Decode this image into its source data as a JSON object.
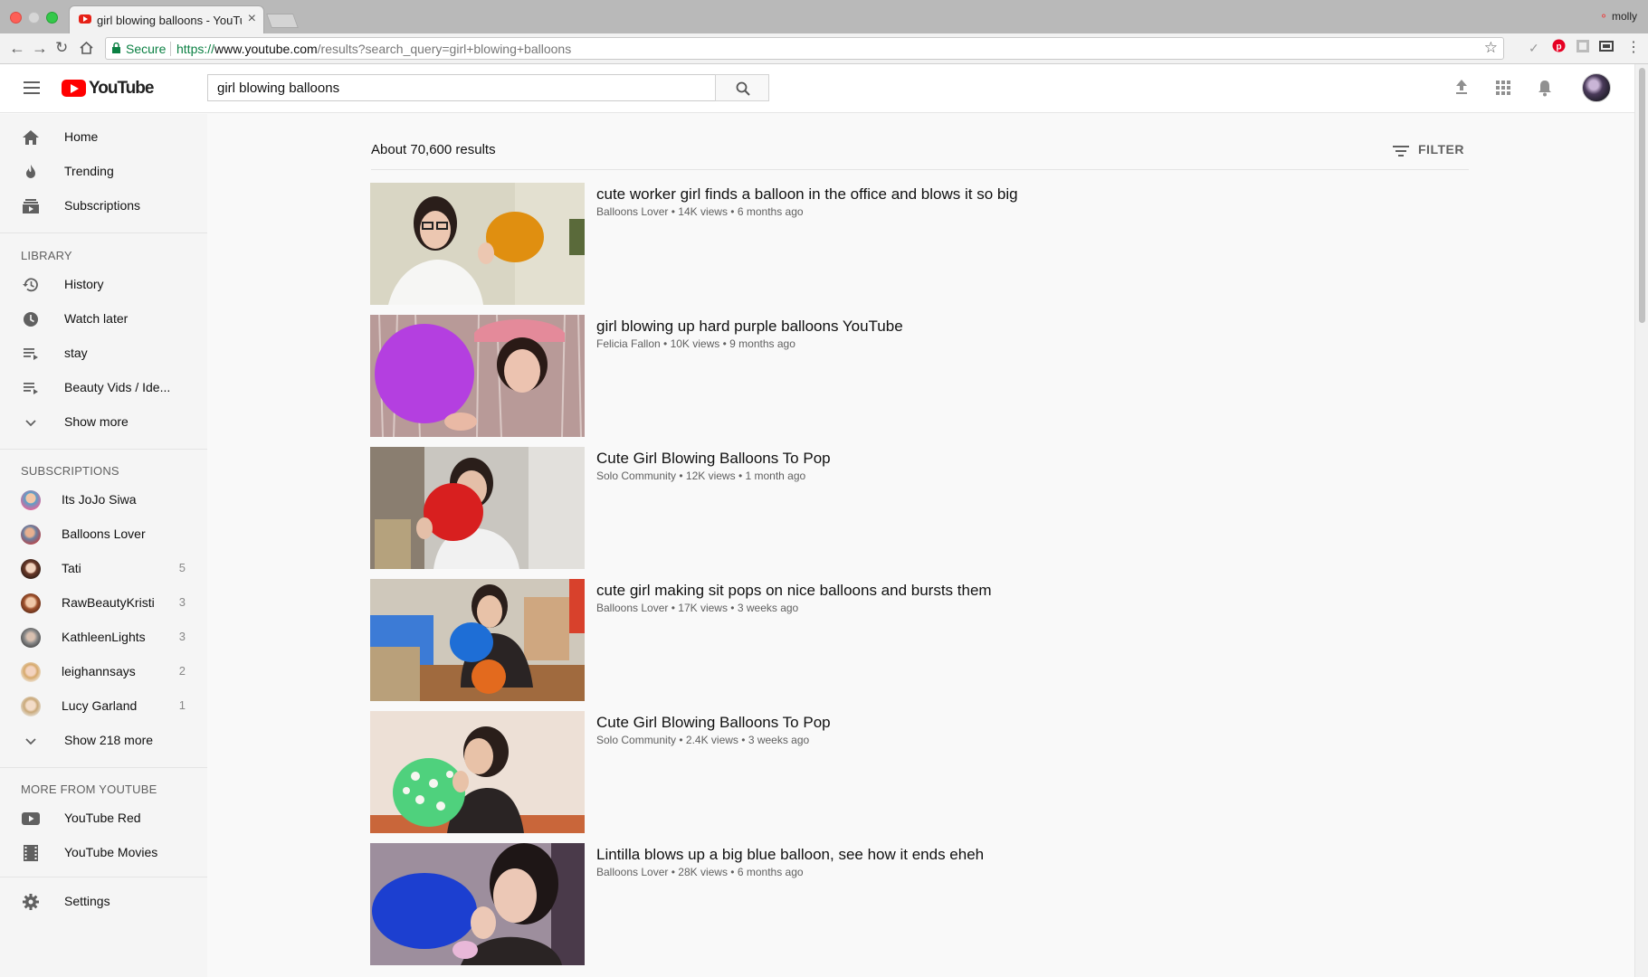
{
  "browser": {
    "tab_title": "girl blowing balloons - YouTube",
    "tab_close": "×",
    "profile": "molly",
    "secure_label": "Secure",
    "url_scheme": "https://",
    "url_host": "www.youtube.com",
    "url_path": "/results?search_query=girl+blowing+balloons"
  },
  "masthead": {
    "logo_text": "YouTube",
    "search_value": "girl blowing balloons",
    "search_placeholder": "Search"
  },
  "sidebar": {
    "main": [
      {
        "label": "Home",
        "icon": "home-icon"
      },
      {
        "label": "Trending",
        "icon": "flame-icon"
      },
      {
        "label": "Subscriptions",
        "icon": "subscriptions-icon"
      }
    ],
    "library_heading": "LIBRARY",
    "library": [
      {
        "label": "History",
        "icon": "history-icon"
      },
      {
        "label": "Watch later",
        "icon": "clock-icon"
      },
      {
        "label": "stay",
        "icon": "playlist-icon"
      },
      {
        "label": "Beauty Vids / Ide...",
        "icon": "playlist-icon"
      },
      {
        "label": "Show more",
        "icon": "chevron-down-icon"
      }
    ],
    "subscriptions_heading": "SUBSCRIPTIONS",
    "subscriptions": [
      {
        "label": "Its JoJo Siwa",
        "count": ""
      },
      {
        "label": "Balloons Lover",
        "count": ""
      },
      {
        "label": "Tati",
        "count": "5"
      },
      {
        "label": "RawBeautyKristi",
        "count": "3"
      },
      {
        "label": "KathleenLights",
        "count": "3"
      },
      {
        "label": "leighannsays",
        "count": "2"
      },
      {
        "label": "Lucy Garland",
        "count": "1"
      }
    ],
    "show_more_subs": "Show 218 more",
    "more_heading": "MORE FROM YOUTUBE",
    "more": [
      {
        "label": "YouTube Red",
        "icon": "youtube-red-icon"
      },
      {
        "label": "YouTube Movies",
        "icon": "film-icon"
      }
    ],
    "settings": "Settings"
  },
  "results": {
    "count_text": "About 70,600 results",
    "filter_label": "FILTER",
    "items": [
      {
        "title": "cute worker girl finds a balloon in the office and blows it so big",
        "channel": "Balloons Lover",
        "views": "14K views",
        "age": "6 months ago",
        "balloon_color": "#e08f10"
      },
      {
        "title": "girl blowing up hard purple balloons YouTube",
        "channel": "Felicia Fallon",
        "views": "10K views",
        "age": "9 months ago",
        "balloon_color": "#b43fe0"
      },
      {
        "title": "Cute Girl Blowing Balloons To Pop",
        "channel": "Solo Community",
        "views": "12K views",
        "age": "1 month ago",
        "balloon_color": "#d81f1f"
      },
      {
        "title": "cute girl making sit pops on nice balloons and bursts them",
        "channel": "Balloons Lover",
        "views": "17K views",
        "age": "3 weeks ago",
        "balloon_color": "#1e6ed6"
      },
      {
        "title": "Cute Girl Blowing Balloons To Pop",
        "channel": "Solo Community",
        "views": "2.4K views",
        "age": "3 weeks ago",
        "balloon_color": "#4fd17d"
      },
      {
        "title": "Lintilla blows up a big blue balloon, see how it ends eheh",
        "channel": "Balloons Lover",
        "views": "28K views",
        "age": "6 months ago",
        "balloon_color": "#1c3fd0"
      }
    ]
  }
}
